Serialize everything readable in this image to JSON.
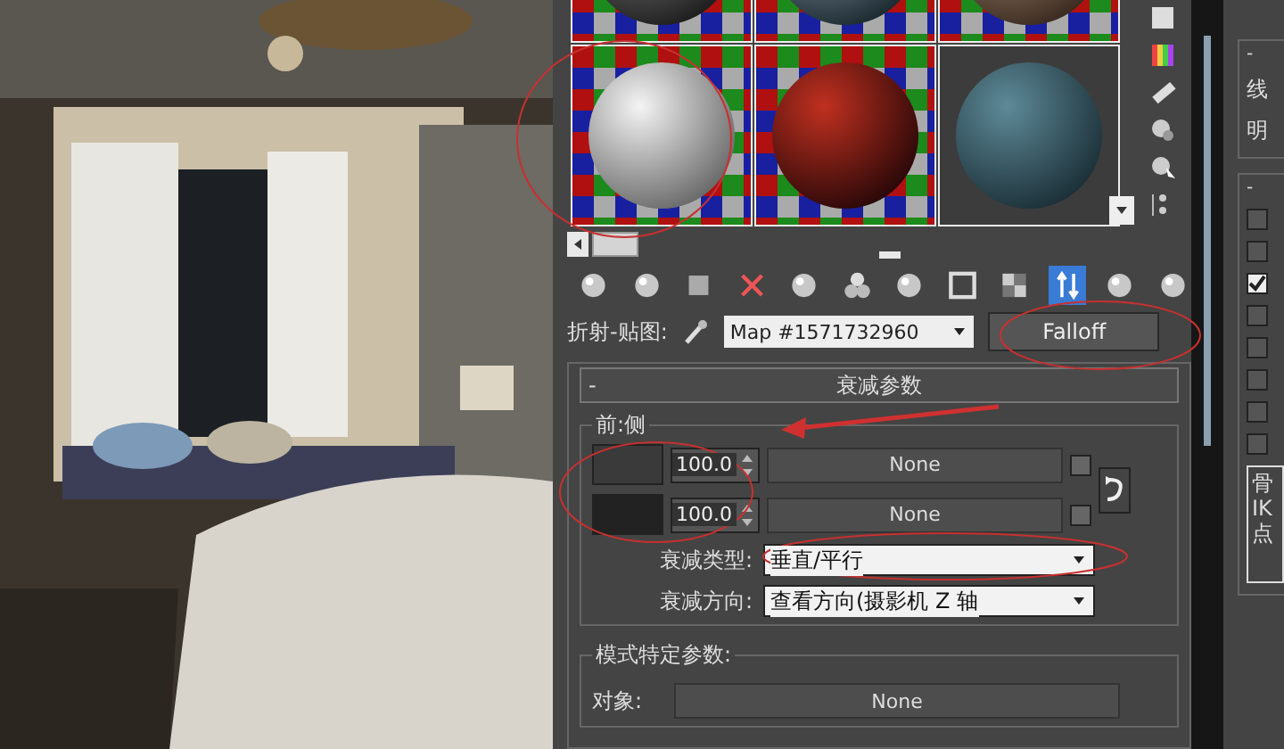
{
  "material_editor": {
    "sample_slots": [
      {
        "kind": "dark"
      },
      {
        "kind": "glossy"
      },
      {
        "kind": "brown"
      },
      {
        "kind": "matte"
      },
      {
        "kind": "checker"
      },
      {
        "kind": "fabric"
      }
    ],
    "map_label": "折射-贴图:",
    "map_name": "Map #1571732960",
    "map_type": "Falloff",
    "rollout": {
      "collapse_glyph": "-",
      "title": "衰减参数",
      "group": "前:侧",
      "rows": [
        {
          "color": "#3a3a3a",
          "value": "100.0",
          "map": "None",
          "enabled": false
        },
        {
          "color": "#222222",
          "value": "100.0",
          "map": "None",
          "enabled": false
        }
      ],
      "falloff_type": {
        "label": "衰减类型:",
        "value": "垂直/平行"
      },
      "falloff_direction": {
        "label": "衰减方向:",
        "value": "查看方向(摄影机 Z 轴"
      }
    },
    "mode_params": {
      "title": "模式特定参数:",
      "object_label": "对象:",
      "object_map": "None"
    }
  },
  "right_panel": {
    "labels": [
      "线",
      "明"
    ],
    "checkboxes": [
      {
        "checked": false
      },
      {
        "checked": false
      },
      {
        "checked": true
      },
      {
        "checked": false
      },
      {
        "checked": false
      },
      {
        "checked": false
      },
      {
        "checked": false
      },
      {
        "checked": false
      }
    ],
    "list": [
      "骨",
      "IK",
      "点"
    ]
  }
}
